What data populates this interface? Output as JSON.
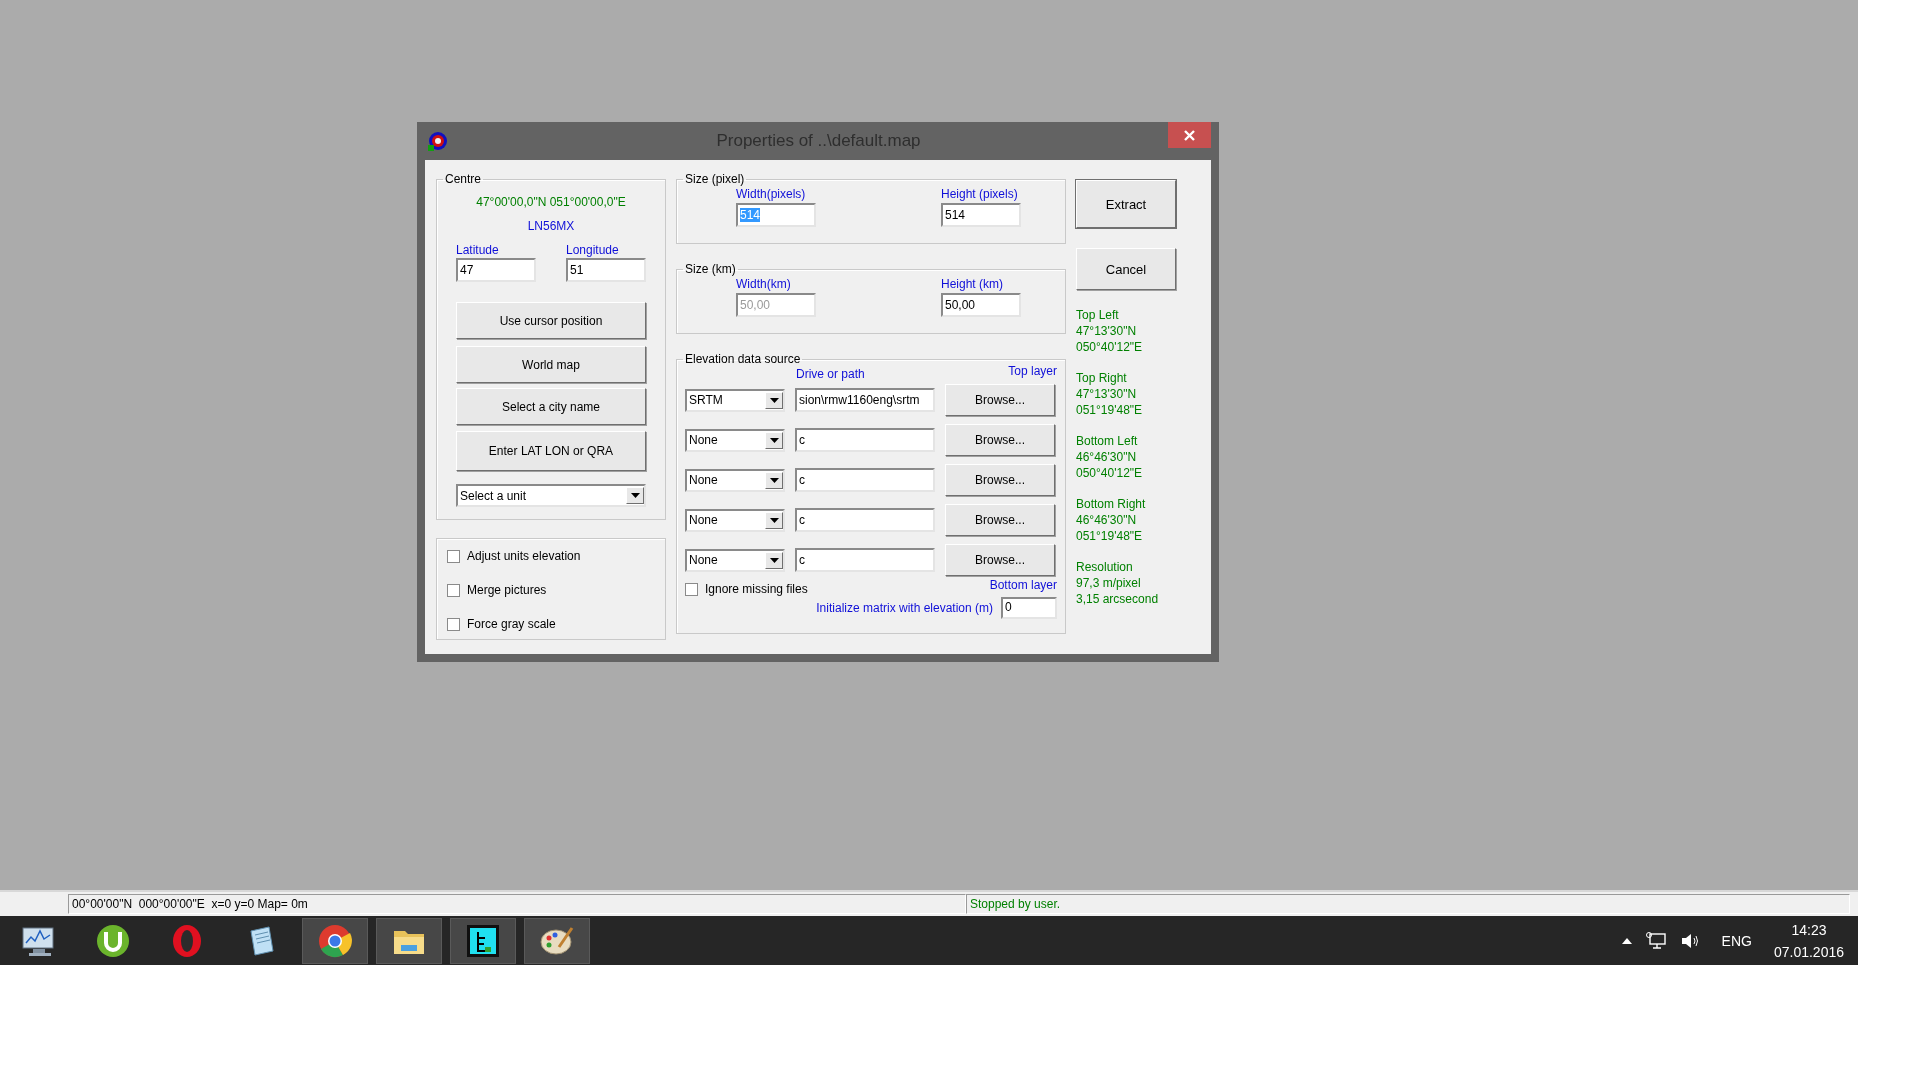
{
  "window": {
    "title": "Properties of ..\\default.map"
  },
  "centre": {
    "legend": "Centre",
    "coordinates": "47°00'00,0\"N 051°00'00,0\"E",
    "locator": "LN56MX",
    "latitude": {
      "label": "Latitude",
      "value": "47"
    },
    "longitude": {
      "label": "Longitude",
      "value": "51"
    },
    "buttons": [
      "Use cursor position",
      "World map",
      "Select a city name",
      "Enter LAT LON or QRA"
    ],
    "unit_select": {
      "value": "Select a unit"
    }
  },
  "options": [
    {
      "label": "Adjust units elevation",
      "checked": false
    },
    {
      "label": "Merge pictures",
      "checked": false
    },
    {
      "label": "Force gray scale",
      "checked": false
    }
  ],
  "size_pixel": {
    "legend": "Size (pixel)",
    "width": {
      "label": "Width(pixels)",
      "value": "514",
      "text_selected": true,
      "disabled": false
    },
    "height": {
      "label": "Height (pixels)",
      "value": "514",
      "text_selected": false,
      "disabled": false
    }
  },
  "size_km": {
    "legend": "Size (km)",
    "width": {
      "label": "Width(km)",
      "value": "50,00",
      "text_selected": false,
      "disabled": true
    },
    "height": {
      "label": "Height (km)",
      "value": "50,00",
      "text_selected": false,
      "disabled": false
    }
  },
  "elevation": {
    "legend": "Elevation data source",
    "path_header": "Drive or path",
    "top_label": "Top layer",
    "sources": [
      {
        "type": "SRTM",
        "path": "sion\\rmw1160eng\\srtm",
        "button": "Browse..."
      },
      {
        "type": "None",
        "path": "c",
        "button": "Browse..."
      },
      {
        "type": "None",
        "path": "c",
        "button": "Browse..."
      },
      {
        "type": "None",
        "path": "c",
        "button": "Browse..."
      },
      {
        "type": "None",
        "path": "c",
        "button": "Browse..."
      }
    ],
    "ignore_missing": {
      "label": "Ignore missing files",
      "checked": false
    },
    "bottom_label": "Bottom layer",
    "init": {
      "label": "Initialize matrix with elevation (m)",
      "value": "0"
    }
  },
  "actions": [
    "Extract",
    "Cancel"
  ],
  "corners": [
    {
      "title": "Top Left",
      "lines": [
        "47°13'30\"N",
        "050°40'12\"E"
      ]
    },
    {
      "title": "Top Right",
      "lines": [
        "47°13'30\"N",
        "051°19'48\"E"
      ]
    },
    {
      "title": "Bottom Left",
      "lines": [
        "46°46'30\"N",
        "050°40'12\"E"
      ]
    },
    {
      "title": "Bottom Right",
      "lines": [
        "46°46'30\"N",
        "051°19'48\"E"
      ]
    },
    {
      "title": "Resolution",
      "lines": [
        "97,3 m/pixel",
        "3,15 arcsecond"
      ]
    }
  ],
  "status_bar": {
    "position": "00°00'00\"N  000°00'00\"E  x=0 y=0 Map= 0m",
    "message": "Stopped by user."
  },
  "taskbar": {
    "apps": [
      {
        "kind": "monitor",
        "running": false
      },
      {
        "kind": "torrent",
        "running": false
      },
      {
        "kind": "browser-o",
        "running": false
      },
      {
        "kind": "notepad",
        "running": false
      },
      {
        "kind": "browser-c",
        "running": true
      },
      {
        "kind": "folder",
        "running": true
      },
      {
        "kind": "map",
        "running": true
      },
      {
        "kind": "paint",
        "running": true
      }
    ],
    "language": "ENG",
    "time": "14:23",
    "date": "07.01.2016"
  }
}
